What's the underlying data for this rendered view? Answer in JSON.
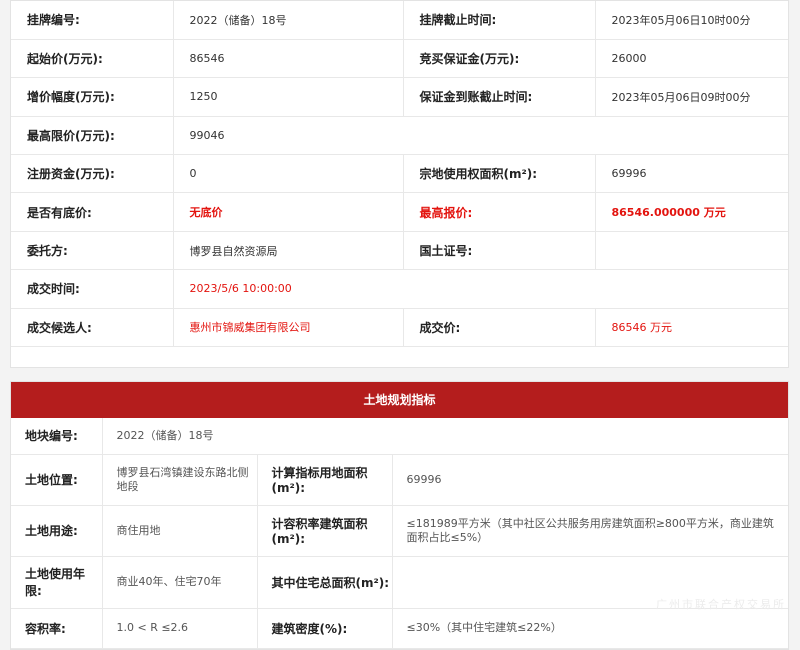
{
  "listing": {
    "rows": [
      [
        {
          "label": "挂牌编号:",
          "value": "2022（储备）18号"
        },
        {
          "label": "挂牌截止时间:",
          "value": "2023年05月06日10时00分"
        }
      ],
      [
        {
          "label": "起始价(万元):",
          "value": "86546"
        },
        {
          "label": "竞买保证金(万元):",
          "value": "26000"
        }
      ],
      [
        {
          "label": "增价幅度(万元):",
          "value": "1250"
        },
        {
          "label": "保证金到账截止时间:",
          "value": "2023年05月06日09时00分"
        }
      ],
      [
        {
          "label": "最高限价(万元):",
          "value": "99046"
        }
      ],
      [
        {
          "label": "注册资金(万元):",
          "value": "0"
        },
        {
          "label": "宗地使用权面积(m²):",
          "value": "69996"
        }
      ],
      [
        {
          "label": "是否有底价:",
          "value": "无底价"
        },
        {
          "label": "最高报价:",
          "value": "86546.000000 万元"
        }
      ],
      [
        {
          "label": "委托方:",
          "value": "博罗县自然资源局"
        },
        {
          "label": "国土证号:",
          "value": ""
        }
      ],
      [
        {
          "label": "成交时间:",
          "value": "2023/5/6 10:00:00"
        }
      ],
      [
        {
          "label": "成交候选人:",
          "value": "惠州市锦威集团有限公司"
        },
        {
          "label": "成交价:",
          "value": "86546 万元"
        }
      ]
    ]
  },
  "planning": {
    "title": "土地规划指标",
    "parcel_no": {
      "label": "地块编号:",
      "value": "2022（储备）18号"
    },
    "location": {
      "label": "土地位置:",
      "value": "博罗县石湾镇建设东路北侧地段"
    },
    "calc_area": {
      "label": "计算指标用地面积(m²):",
      "value": "69996"
    },
    "use": {
      "label": "土地用途:",
      "value": "商住用地"
    },
    "far_area": {
      "label": "计容积率建筑面积(m²):",
      "value": "≤181989平方米（其中社区公共服务用房建筑面积≥800平方米，商业建筑面积占比≤5%）"
    },
    "term": {
      "label": "土地使用年限:",
      "value": "商业40年、住宅70年"
    },
    "res_area": {
      "label": "其中住宅总面积(m²):",
      "value": ""
    },
    "far": {
      "label": "容积率:",
      "value": "1.0 < R ≤2.6"
    },
    "density": {
      "label": "建筑密度(%):",
      "value": "≤30%（其中住宅建筑≤22%）"
    }
  },
  "watermark": "广州市联合产权交易所"
}
